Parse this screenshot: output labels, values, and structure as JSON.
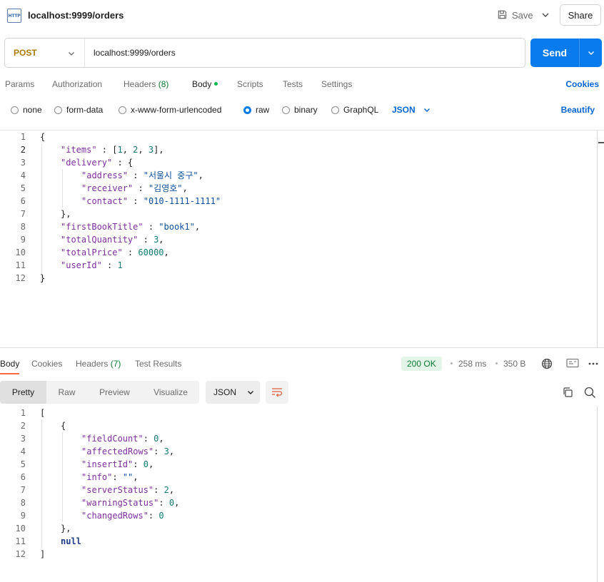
{
  "header": {
    "badge": "HTTP",
    "title": "localhost:9999/orders",
    "save_label": "Save",
    "share_label": "Share"
  },
  "request": {
    "method": "POST",
    "url": "localhost:9999/orders",
    "send_label": "Send"
  },
  "request_tabs": {
    "params": "Params",
    "authorization": "Authorization",
    "headers": "Headers",
    "headers_count": "(8)",
    "body": "Body",
    "scripts": "Scripts",
    "tests": "Tests",
    "settings": "Settings",
    "cookies": "Cookies"
  },
  "body_types": {
    "none": "none",
    "form_data": "form-data",
    "urlencoded": "x-www-form-urlencoded",
    "raw": "raw",
    "binary": "binary",
    "graphql": "GraphQL",
    "selected": "raw",
    "language": "JSON",
    "beautify": "Beautify"
  },
  "request_body": {
    "line_numbers": [
      "1",
      "2",
      "3",
      "4",
      "5",
      "6",
      "7",
      "8",
      "9",
      "10",
      "11",
      "12"
    ],
    "tokens": {
      "l1_open": "{",
      "l2_key": "\"items\"",
      "l2_sep": " : [",
      "l2_v1": "1",
      "l2_c1": ", ",
      "l2_v2": "2",
      "l2_c2": ", ",
      "l2_v3": "3",
      "l2_end": "],",
      "l3_key": "\"delivery\"",
      "l3_sep": " : {",
      "l4_key": "\"address\"",
      "l4_sep": " : ",
      "l4_val": "\"서울시 중구\"",
      "l4_end": ",",
      "l5_key": "\"receiver\"",
      "l5_sep": " : ",
      "l5_val": "\"김영호\"",
      "l5_end": ",",
      "l6_key": "\"contact\"",
      "l6_sep": " : ",
      "l6_val": "\"010-1111-1111\"",
      "l7_close": "},",
      "l8_key": "\"firstBookTitle\"",
      "l8_sep": " : ",
      "l8_val": "\"book1\"",
      "l8_end": ",",
      "l9_key": "\"totalQuantity\"",
      "l9_sep": " : ",
      "l9_val": "3",
      "l9_end": ",",
      "l10_key": "\"totalPrice\"",
      "l10_sep": " : ",
      "l10_val": "60000",
      "l10_end": ",",
      "l11_key": "\"userId\"",
      "l11_sep": " : ",
      "l11_val": "1",
      "l12_close": "}"
    }
  },
  "response_tabs": {
    "body": "Body",
    "cookies": "Cookies",
    "headers": "Headers",
    "headers_count": "(7)",
    "test_results": "Test Results",
    "status": "200 OK",
    "time": "258 ms",
    "size": "350 B"
  },
  "response_view": {
    "pretty": "Pretty",
    "raw": "Raw",
    "preview": "Preview",
    "visualize": "Visualize",
    "format": "JSON"
  },
  "response_body": {
    "line_numbers": [
      "1",
      "2",
      "3",
      "4",
      "5",
      "6",
      "7",
      "8",
      "9",
      "10",
      "11",
      "12"
    ],
    "tokens": {
      "l1_open": "[",
      "l2_open": "{",
      "l3_key": "\"fieldCount\"",
      "l3_sep": ": ",
      "l3_val": "0",
      "l3_end": ",",
      "l4_key": "\"affectedRows\"",
      "l4_sep": ": ",
      "l4_val": "3",
      "l4_end": ",",
      "l5_key": "\"insertId\"",
      "l5_sep": ": ",
      "l5_val": "0",
      "l5_end": ",",
      "l6_key": "\"info\"",
      "l6_sep": ": ",
      "l6_val": "\"\"",
      "l6_end": ",",
      "l7_key": "\"serverStatus\"",
      "l7_sep": ": ",
      "l7_val": "2",
      "l7_end": ",",
      "l8_key": "\"warningStatus\"",
      "l8_sep": ": ",
      "l8_val": "0",
      "l8_end": ",",
      "l9_key": "\"changedRows\"",
      "l9_sep": ": ",
      "l9_val": "0",
      "l10_close": "},",
      "l11_null": "null",
      "l12_close": "]"
    }
  },
  "icons": {
    "save": "save-icon",
    "chevron": "chevron-down-icon",
    "globe": "globe-icon",
    "example": "save-example-icon",
    "more": "more-horizontal-icon",
    "wrap": "wrap-lines-icon",
    "copy": "copy-icon",
    "search": "search-icon"
  },
  "colors": {
    "send": "#097bed",
    "method": "#ad7a03",
    "link": "#0265d2",
    "status_ok": "#0f7b36",
    "active_tab": "#f26b3a",
    "json_key": "#7d2e9f",
    "json_string": "#0b4e9c",
    "json_number": "#127c72"
  }
}
